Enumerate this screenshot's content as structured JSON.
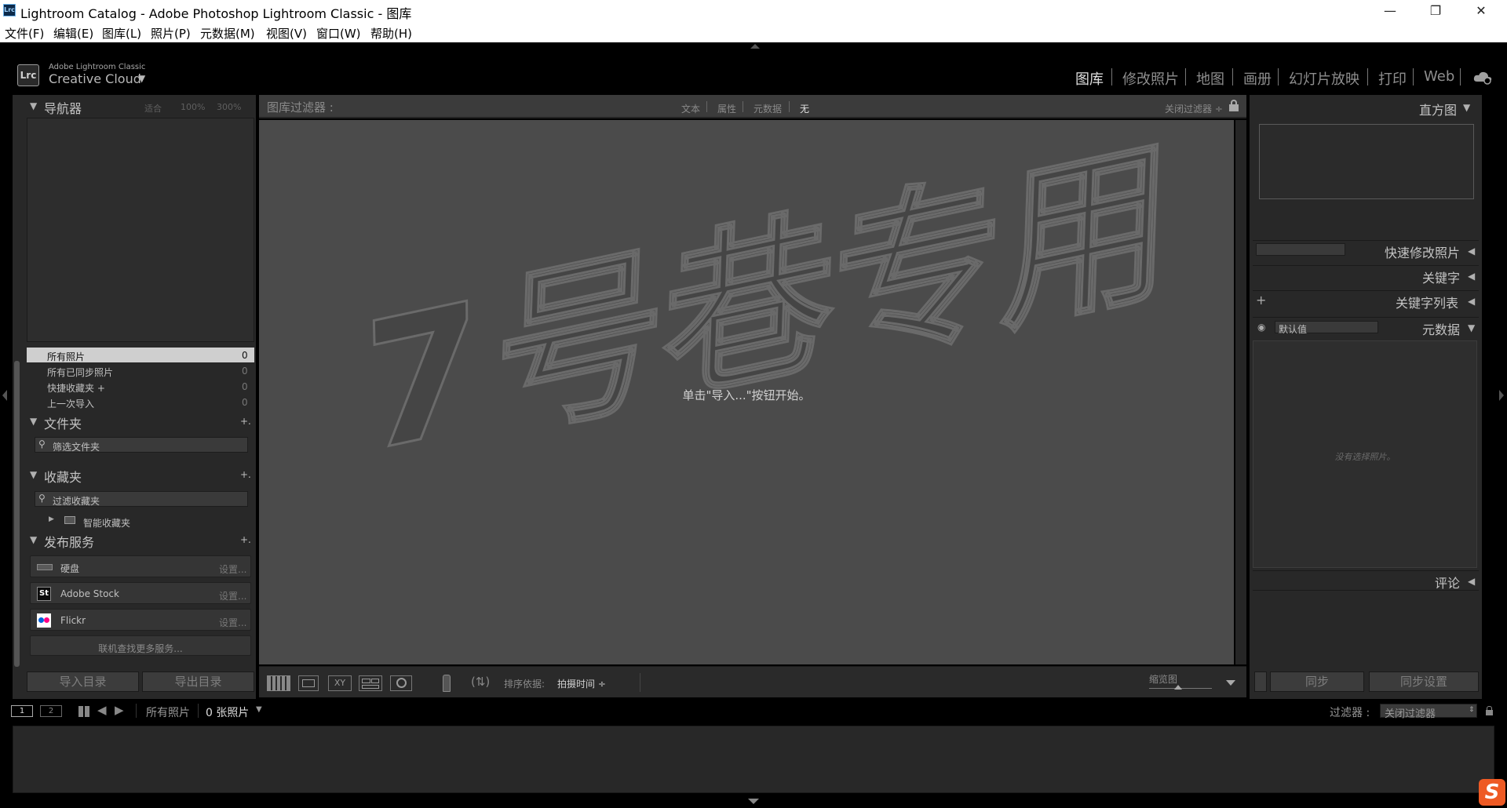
{
  "window": {
    "title": "Lightroom Catalog - Adobe Photoshop Lightroom Classic - 图库",
    "app_icon_text": "Lrc",
    "controls": {
      "minimize": "—",
      "maximize": "❐",
      "close": "✕"
    }
  },
  "menu": [
    "文件(F)",
    "编辑(E)",
    "图库(L)",
    "照片(P)",
    "元数据(M)",
    "视图(V)",
    "窗口(W)",
    "帮助(H)"
  ],
  "identity": {
    "logo": "Lrc",
    "brand_small": "Adobe Lightroom Classic",
    "brand_big": "Creative Cloud",
    "dropdown": "▼"
  },
  "modules": [
    {
      "label": "图库",
      "active": true
    },
    {
      "label": "修改照片",
      "active": false
    },
    {
      "label": "地图",
      "active": false
    },
    {
      "label": "画册",
      "active": false
    },
    {
      "label": "幻灯片放映",
      "active": false
    },
    {
      "label": "打印",
      "active": false
    },
    {
      "label": "Web",
      "active": false
    }
  ],
  "left_panel": {
    "navigator": {
      "title": "导航器",
      "zoom": [
        "适合",
        "100%",
        "300%"
      ]
    },
    "catalog": [
      {
        "label": "所有照片",
        "count": "0"
      },
      {
        "label": "所有已同步照片",
        "count": "0"
      },
      {
        "label": "快捷收藏夹 +",
        "count": "0"
      },
      {
        "label": "上一次导入",
        "count": "0"
      }
    ],
    "folders": {
      "title": "文件夹",
      "add": "+.",
      "filter_placeholder": "筛选文件夹"
    },
    "collections": {
      "title": "收藏夹",
      "add": "+.",
      "filter_placeholder": "过滤收藏夹",
      "smart_collection": "智能收藏夹"
    },
    "publish": {
      "title": "发布服务",
      "add": "+.",
      "services": [
        {
          "icon": "hard-drive",
          "label": "硬盘",
          "action": "设置..."
        },
        {
          "icon": "St",
          "label": "Adobe Stock",
          "action": "设置..."
        },
        {
          "icon": "flickr",
          "label": "Flickr",
          "action": "设置..."
        }
      ],
      "find_more": "联机查找更多服务..."
    },
    "import_button": "导入目录",
    "export_button": "导出目录"
  },
  "filter_bar": {
    "title": "图库过滤器 :",
    "tabs": [
      "文本",
      "属性",
      "元数据",
      "无"
    ],
    "active_tab": "无",
    "preset": "关闭过滤器 ÷"
  },
  "main": {
    "empty_message": "单击\"导入...\"按钮开始。",
    "watermark": "7号巷专用"
  },
  "toolbar": {
    "sort_label": "排序依据:",
    "sort_value": "拍摄时间 ÷",
    "thumb_label": "缩览图"
  },
  "right_panel": {
    "histogram": "直方图",
    "quick_develop": "快速修改照片",
    "keywording": "关键字",
    "keyword_list": "关键字列表",
    "metadata": "元数据",
    "metadata_preset": "默认值",
    "no_photo": "没有选择照片。",
    "comments": "评论",
    "sync": "同步",
    "sync_settings": "同步设置"
  },
  "filmstrip": {
    "screen1": "1",
    "screen2": "2",
    "source": "所有照片",
    "count": "0 张照片",
    "filter_label": "过滤器 :",
    "filter_value": "关闭过滤器"
  },
  "colors": {
    "background": "#000000",
    "panel": "#282828",
    "center": "#4b4b4b",
    "text": "#b8b8b8"
  }
}
